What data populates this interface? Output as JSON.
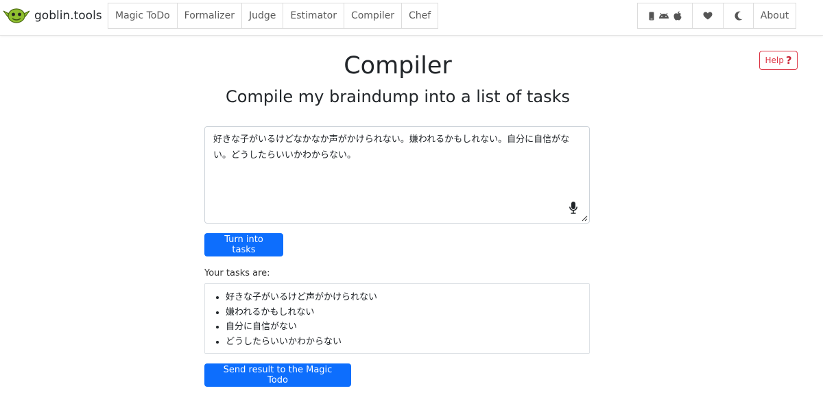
{
  "brand": {
    "name": "goblin.tools"
  },
  "nav": {
    "items": [
      {
        "label": "Magic ToDo"
      },
      {
        "label": "Formalizer"
      },
      {
        "label": "Judge"
      },
      {
        "label": "Estimator"
      },
      {
        "label": "Compiler"
      },
      {
        "label": "Chef"
      }
    ],
    "right": {
      "apps_icons": [
        "mobile-icon",
        "android-icon",
        "apple-icon"
      ],
      "heart_icon": "heart-icon",
      "theme_icon": "moon-icon",
      "about_label": "About"
    }
  },
  "help": {
    "label": "Help",
    "icon": "question-mark-icon",
    "color": "#dc3545"
  },
  "page": {
    "title": "Compiler",
    "subtitle": "Compile my braindump into a list of tasks"
  },
  "input": {
    "value": "好きな子がいるけどなかなか声がかけられない。嫌われるかもしれない。自分に自信がない。どうしたらいいかわからない。",
    "mic_icon": "microphone-icon"
  },
  "actions": {
    "turn_label": "Turn into tasks",
    "send_label": "Send result to the Magic Todo",
    "primary_color": "#0d6efd"
  },
  "results": {
    "label": "Your tasks are:",
    "tasks": [
      "好きな子がいるけど声がかけられない",
      "嫌われるかもしれない",
      "自分に自信がない",
      "どうしたらいいかわからない"
    ]
  }
}
